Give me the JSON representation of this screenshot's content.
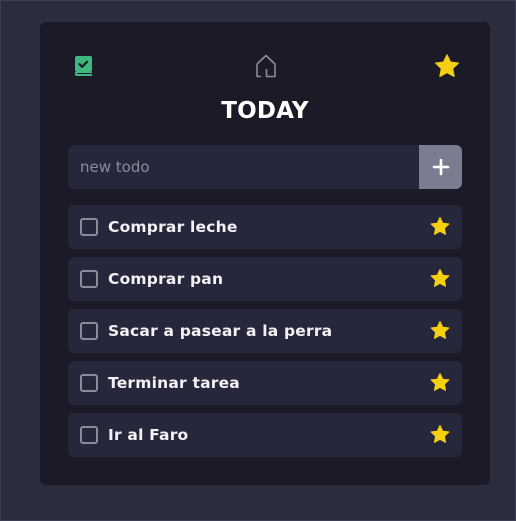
{
  "header": {
    "title": "TODAY",
    "icons": {
      "left": "book-check-icon",
      "center": "home-icon",
      "right": "star-icon"
    },
    "colors": {
      "book": "#3fb87f",
      "home": "#8a8c9c",
      "star": "#f5cf12"
    }
  },
  "new_todo": {
    "placeholder": "new todo",
    "value": "",
    "add_icon": "plus-icon"
  },
  "todos": [
    {
      "label": "Comprar leche",
      "done": false,
      "starred": true
    },
    {
      "label": "Comprar pan",
      "done": false,
      "starred": true
    },
    {
      "label": "Sacar a pasear a la perra",
      "done": false,
      "starred": true
    },
    {
      "label": "Terminar tarea",
      "done": false,
      "starred": true
    },
    {
      "label": "Ir al Faro",
      "done": false,
      "starred": true
    }
  ]
}
